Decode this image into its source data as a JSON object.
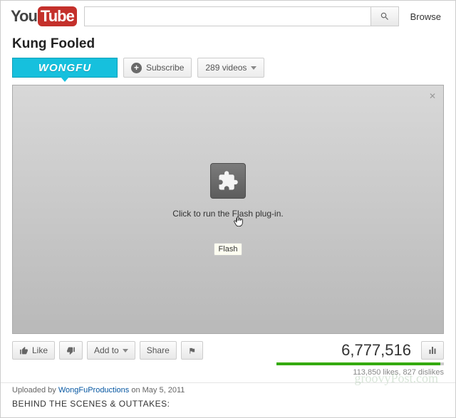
{
  "header": {
    "logo": {
      "you": "You",
      "tube": "Tube"
    },
    "search_placeholder": "",
    "browse_label": "Browse"
  },
  "video": {
    "title": "Kung Fooled",
    "channel_badge_text": "WONGFU"
  },
  "channel_actions": {
    "subscribe_label": "Subscribe",
    "videos_count_label": "289 videos"
  },
  "player": {
    "plugin_text": "Click to run the Flash plug-in.",
    "tooltip": "Flash",
    "close_glyph": "✕"
  },
  "actions": {
    "like_label": "Like",
    "add_to_label": "Add to",
    "share_label": "Share"
  },
  "stats": {
    "views": "6,777,516",
    "likes_text": "113,850 likes, 827 dislikes"
  },
  "meta": {
    "uploaded_prefix": "Uploaded by ",
    "uploader": "WongFuProductions",
    "uploaded_suffix": " on May 5, 2011",
    "desc_cut": "BEHIND THE SCENES & OUTTAKES:"
  },
  "watermark": "groovyPost.com"
}
